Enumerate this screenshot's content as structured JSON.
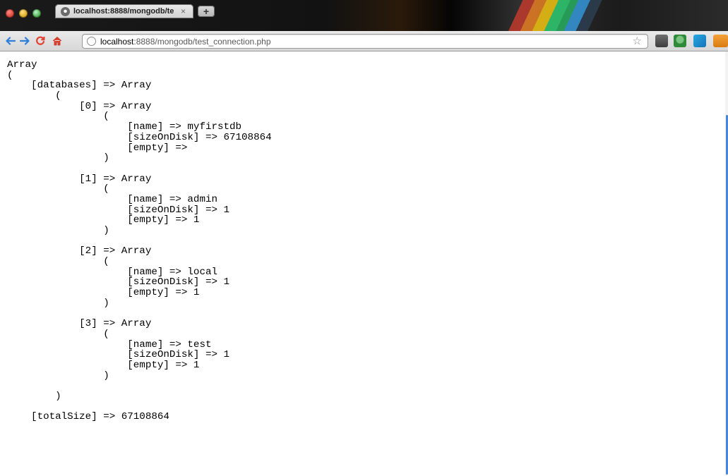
{
  "tab": {
    "title": "localhost:8888/mongodb/te",
    "close_glyph": "×",
    "new_tab_glyph": "+"
  },
  "omnibox": {
    "host": "localhost",
    "rest": ":8888/mongodb/test_connection.php"
  },
  "icons": {
    "back": "arrow-left-icon",
    "forward": "arrow-right-icon",
    "reload": "reload-icon",
    "home": "home-icon",
    "star": "star-icon"
  },
  "colors": {
    "nav_arrows": "#2f7fd8",
    "reload": "#e3402f",
    "home": "#e3402f",
    "scroll_accent": "#4a86d4"
  },
  "output_lines": [
    "Array",
    "(",
    "    [databases] => Array",
    "        (",
    "            [0] => Array",
    "                (",
    "                    [name] => myfirstdb",
    "                    [sizeOnDisk] => 67108864",
    "                    [empty] => ",
    "                )",
    "",
    "            [1] => Array",
    "                (",
    "                    [name] => admin",
    "                    [sizeOnDisk] => 1",
    "                    [empty] => 1",
    "                )",
    "",
    "            [2] => Array",
    "                (",
    "                    [name] => local",
    "                    [sizeOnDisk] => 1",
    "                    [empty] => 1",
    "                )",
    "",
    "            [3] => Array",
    "                (",
    "                    [name] => test",
    "                    [sizeOnDisk] => 1",
    "                    [empty] => 1",
    "                )",
    "",
    "        )",
    "",
    "    [totalSize] => 67108864"
  ]
}
